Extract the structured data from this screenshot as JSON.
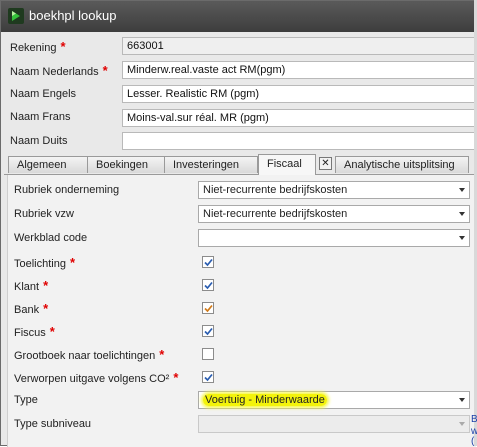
{
  "window": {
    "title": "boekhpl lookup"
  },
  "fields": {
    "rekening": {
      "label": "Rekening",
      "value": "663001"
    },
    "naam_nl": {
      "label": "Naam Nederlands",
      "value": "Minderw.real.vaste act RM(pgm)"
    },
    "naam_en": {
      "label": "Naam Engels",
      "value": "Lesser. Realistic RM (pgm)"
    },
    "naam_fr": {
      "label": "Naam Frans",
      "value": "Moins-val.sur réal. MR (pgm)"
    },
    "naam_de": {
      "label": "Naam Duits",
      "value": ""
    }
  },
  "required_marker": "*",
  "tabs": [
    {
      "label": "Algemeen"
    },
    {
      "label": "Boekingen"
    },
    {
      "label": "Investeringen"
    },
    {
      "label": "Fiscaal"
    },
    {
      "label": "Analytische uitsplitsing"
    }
  ],
  "active_tab": "Fiscaal",
  "close_glyph": "✕",
  "fiscaal": {
    "rubriek_onderneming": {
      "label": "Rubriek onderneming",
      "value": "Niet-recurrente bedrijfskosten"
    },
    "rubriek_vzw": {
      "label": "Rubriek vzw",
      "value": "Niet-recurrente bedrijfskosten"
    },
    "werkblad_code": {
      "label": "Werkblad code",
      "value": ""
    },
    "toelichting": {
      "label": "Toelichting",
      "checked": true
    },
    "klant": {
      "label": "Klant",
      "checked": true
    },
    "bank": {
      "label": "Bank",
      "checked": true
    },
    "fiscus": {
      "label": "Fiscus",
      "checked": true
    },
    "grootboek": {
      "label": "Grootboek naar toelichtingen",
      "checked": false
    },
    "verworpen": {
      "label": "Verworpen uitgave volgens CO²",
      "checked": true
    },
    "type": {
      "label": "Type",
      "value": "Voertuig - Minderwaarde"
    },
    "type_subniveau": {
      "label": "Type subniveau",
      "value": ""
    }
  },
  "side_fragments": [
    "B",
    "w",
    "("
  ],
  "colors": {
    "required": "#e00000",
    "highlight": "#f3f30b",
    "check_blue": "#2a5db0",
    "check_orange": "#d07a1a"
  }
}
